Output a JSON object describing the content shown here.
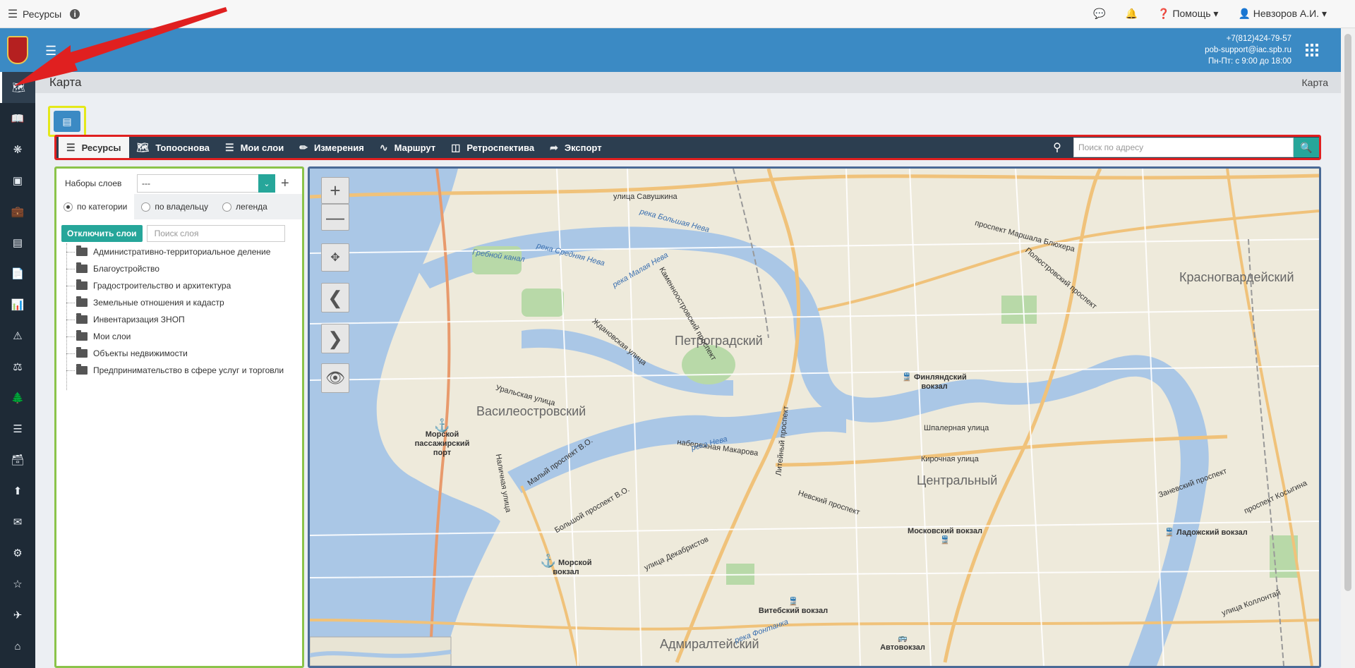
{
  "topbar": {
    "app_title": "Ресурсы",
    "help_label": "Помощь",
    "user_name": "Невзоров А.И."
  },
  "header": {
    "phone": "+7(812)424-79-57",
    "email": "pob-support@iac.spb.ru",
    "hours": "Пн-Пт: с 9:00 до 18:00"
  },
  "page": {
    "title": "Карта",
    "breadcrumb": "Карта"
  },
  "map_toolbar": {
    "tabs": [
      {
        "label": "Ресурсы",
        "icon": "layers-icon"
      },
      {
        "label": "Топооснова",
        "icon": "map-icon"
      },
      {
        "label": "Мои слои",
        "icon": "layers-icon"
      },
      {
        "label": "Измерения",
        "icon": "ruler-icon"
      },
      {
        "label": "Маршрут",
        "icon": "route-icon"
      },
      {
        "label": "Ретроспектива",
        "icon": "history-icon"
      },
      {
        "label": "Экспорт",
        "icon": "export-icon"
      }
    ],
    "search_placeholder": "Поиск по адресу"
  },
  "layers_panel": {
    "sets_label": "Наборы слоев",
    "sets_value": "---",
    "radio_options": [
      "по категории",
      "по владельцу",
      "легенда"
    ],
    "selected_radio": "по категории",
    "disable_button": "Отключить слои",
    "layer_search_placeholder": "Поиск слоя",
    "tree": [
      {
        "label": "Административно-территориальное деление"
      },
      {
        "label": "Благоустройство"
      },
      {
        "label": "Градостроительство и архитектура"
      },
      {
        "label": "Земельные отношения и кадастр"
      },
      {
        "label": "Инвентаризация ЗНОП"
      },
      {
        "label": "Мои слои"
      },
      {
        "label": "Объекты недвижимости"
      },
      {
        "label": "Предпринимательство в сфере услуг и торговли"
      }
    ]
  },
  "map": {
    "districts": [
      "Петроградский",
      "Василеостровский",
      "Центральный",
      "Красногвардейский",
      "Адмиралтейский"
    ],
    "poi": {
      "finland": "Финляндский вокзал",
      "port": "Морской пассажирский порт",
      "sea_station": "Морской вокзал",
      "moscow": "Московский вокзал",
      "ladoga": "Ладожский вокзал",
      "vitebsk": "Витебский вокзал",
      "avtovokzal": "Автовокзал"
    },
    "streets": {
      "s1": "улица Савушкина",
      "s2": "Шпалерная улица",
      "s3": "Кирочная улица",
      "s4": "Невский проспект",
      "s5": "проспект Маршала Блюхера",
      "s6": "Уральская улица",
      "s7": "Малый проспект В.О.",
      "s8": "набережная Макарова",
      "s9": "Большой проспект В.О.",
      "s10": "улица Декабристов",
      "s11": "Литейный проспект",
      "s12": "Полюстровский проспект",
      "s13": "Заневский проспект",
      "s14": "проспект Косыгина",
      "s15": "Наличная улица",
      "s16": "Ждановская улица",
      "s17": "Каменноостровский проспект",
      "s18": "улица Коллонтай"
    },
    "rivers": {
      "r1": "река Большая Нева",
      "r2": "река Малая Нева",
      "r3": "река Средняя Нева",
      "r4": "река Нева",
      "r5": "река Фонтанка",
      "r6": "Гребной канал"
    }
  },
  "colors": {
    "header_blue": "#3b8ac4",
    "sidebar_dark": "#1e2a36",
    "toolbar_dark": "#2c3e50",
    "accent_green": "#26a69a",
    "highlight_red": "#e02020",
    "highlight_yellow": "#e4e81a",
    "highlight_green": "#8bc34a",
    "map_frame_blue": "#4a6a96",
    "water": "#aac7e6"
  }
}
